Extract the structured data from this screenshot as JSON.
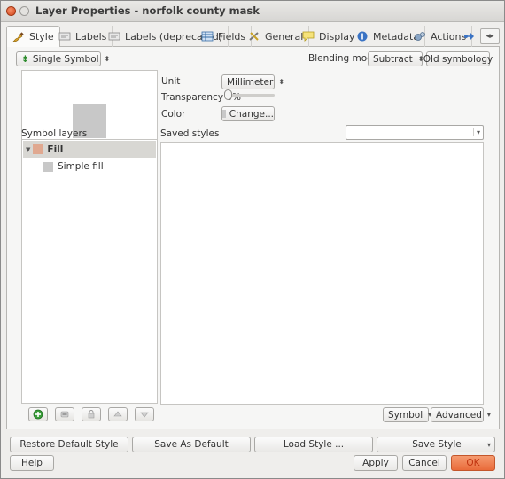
{
  "window": {
    "title": "Layer Properties - norfolk county mask"
  },
  "tabs": [
    {
      "label": "Style",
      "icon": "paintbrush-icon"
    },
    {
      "label": "Labels",
      "icon": "label-icon"
    },
    {
      "label": "Labels (deprecated)",
      "icon": "label-icon"
    },
    {
      "label": "Fields",
      "icon": "table-icon"
    },
    {
      "label": "General",
      "icon": "tools-icon"
    },
    {
      "label": "Display",
      "icon": "speech-bubble-icon"
    },
    {
      "label": "Metadata",
      "icon": "info-icon"
    },
    {
      "label": "Actions",
      "icon": "gears-icon"
    }
  ],
  "style": {
    "renderer_type": "Single Symbol",
    "blending_mode_label": "Blending mode",
    "blending_mode_value": "Subtract",
    "old_symbology_label": "Old symbology",
    "unit_label": "Unit",
    "unit_value": "Millimeter",
    "transparency_label": "Transparency 0%",
    "transparency_value": 0,
    "color_label": "Color",
    "change_label": "Change...",
    "symbol_layers_label": "Symbol layers",
    "saved_styles_label": "Saved styles",
    "tree": [
      {
        "label": "Fill",
        "color": "#e0a890"
      },
      {
        "label": "Simple fill",
        "color": "#c8c8c8"
      }
    ],
    "symbol_dropdown": "Symbol",
    "advanced_dropdown": "Advanced"
  },
  "footer": {
    "restore_default": "Restore Default Style",
    "save_as_default": "Save As Default",
    "load_style": "Load Style ...",
    "save_style": "Save Style",
    "help": "Help",
    "apply": "Apply",
    "cancel": "Cancel",
    "ok": "OK"
  },
  "colors": {
    "accent": "#e96a3a",
    "fill_swatch": "#e0a890",
    "preview_fill": "#c8c8c8"
  }
}
